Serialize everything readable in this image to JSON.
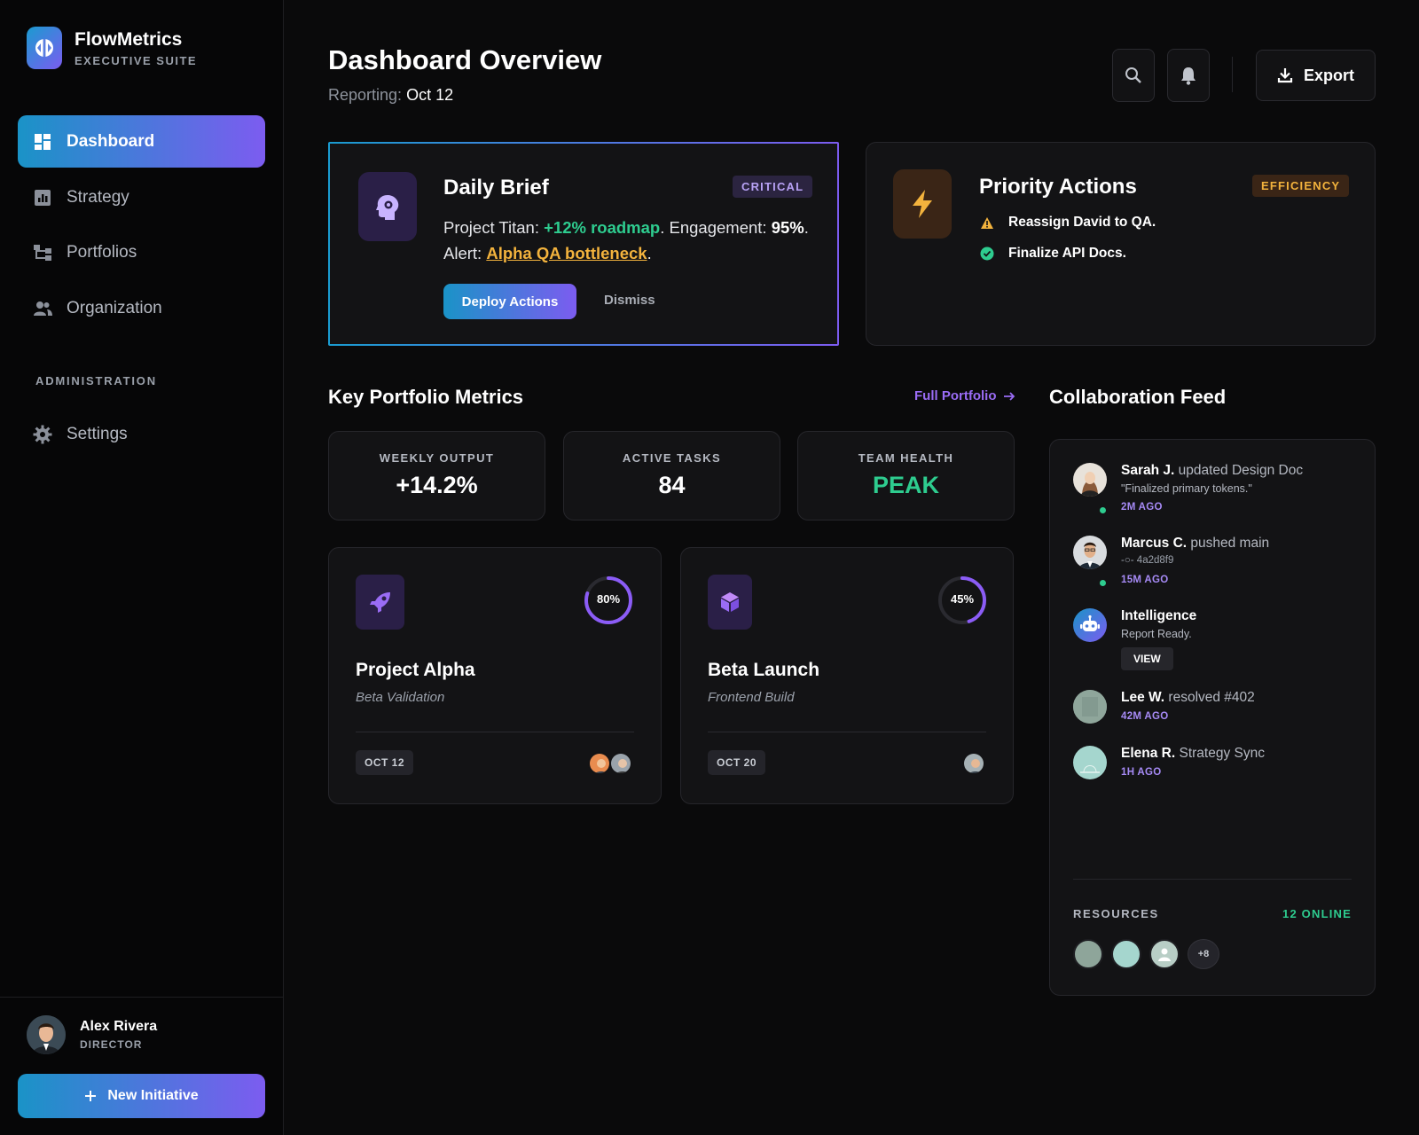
{
  "brand": {
    "title": "FlowMetrics",
    "subtitle": "EXECUTIVE SUITE"
  },
  "nav": {
    "items": [
      {
        "label": "Dashboard",
        "icon": "dashboard-icon",
        "active": true
      },
      {
        "label": "Strategy",
        "icon": "chart-icon"
      },
      {
        "label": "Portfolios",
        "icon": "hierarchy-icon"
      },
      {
        "label": "Organization",
        "icon": "people-icon"
      }
    ],
    "section": "ADMINISTRATION",
    "settings": "Settings"
  },
  "user": {
    "name": "Alex Rivera",
    "role": "DIRECTOR"
  },
  "new_initiative": "New Initiative",
  "header": {
    "title": "Dashboard Overview",
    "reporting_label": "Reporting:",
    "reporting_value": "Oct 12",
    "export": "Export"
  },
  "brief": {
    "title": "Daily Brief",
    "badge": "CRITICAL",
    "line1_a": "Project Titan: ",
    "line1_green": "+12% roadmap",
    "line1_b": ". Engagement: ",
    "line1_bold": "95%",
    "line1_c": ".",
    "line2_a": "Alert: ",
    "line2_amber": "Alpha QA bottleneck",
    "line2_b": ".",
    "deploy": "Deploy Actions",
    "dismiss": "Dismiss"
  },
  "priority": {
    "title": "Priority Actions",
    "badge": "EFFICIENCY",
    "items": [
      {
        "text": "Reassign David to QA.",
        "icon": "warning-icon"
      },
      {
        "text": "Finalize API Docs.",
        "icon": "check-circle-icon"
      }
    ]
  },
  "metrics": {
    "title": "Key Portfolio Metrics",
    "link": "Full Portfolio",
    "cards": [
      {
        "label": "WEEKLY OUTPUT",
        "value": "+14.2%"
      },
      {
        "label": "ACTIVE TASKS",
        "value": "84"
      },
      {
        "label": "TEAM HEALTH",
        "value": "PEAK"
      }
    ]
  },
  "projects": [
    {
      "name": "Project Alpha",
      "sub": "Beta Validation",
      "progress": 80,
      "progress_label": "80%",
      "date": "OCT 12",
      "icon": "rocket-icon"
    },
    {
      "name": "Beta Launch",
      "sub": "Frontend Build",
      "progress": 45,
      "progress_label": "45%",
      "date": "OCT 20",
      "icon": "cube-icon"
    }
  ],
  "feed": {
    "title": "Collaboration Feed",
    "items": [
      {
        "name": "Sarah J.",
        "action": " updated Design Doc",
        "detail": "\"Finalized primary tokens.\"",
        "time": "2M AGO"
      },
      {
        "name": "Marcus C.",
        "action": " pushed main",
        "detail": "-○- 4a2d8f9",
        "time": "15M AGO"
      },
      {
        "name": "Intelligence",
        "action": "",
        "detail": "Report Ready.",
        "button": "VIEW"
      },
      {
        "name": "Lee W.",
        "action": " resolved #402",
        "time": "42M AGO"
      },
      {
        "name": "Elena R.",
        "action": " Strategy Sync",
        "time": "1H AGO"
      }
    ],
    "resources_label": "RESOURCES",
    "online": "12 ONLINE",
    "more": "+8"
  },
  "colors": {
    "accent_start": "#1a93c7",
    "accent_end": "#7c5cf0",
    "green": "#2ecc8f",
    "amber": "#f3b33d"
  }
}
